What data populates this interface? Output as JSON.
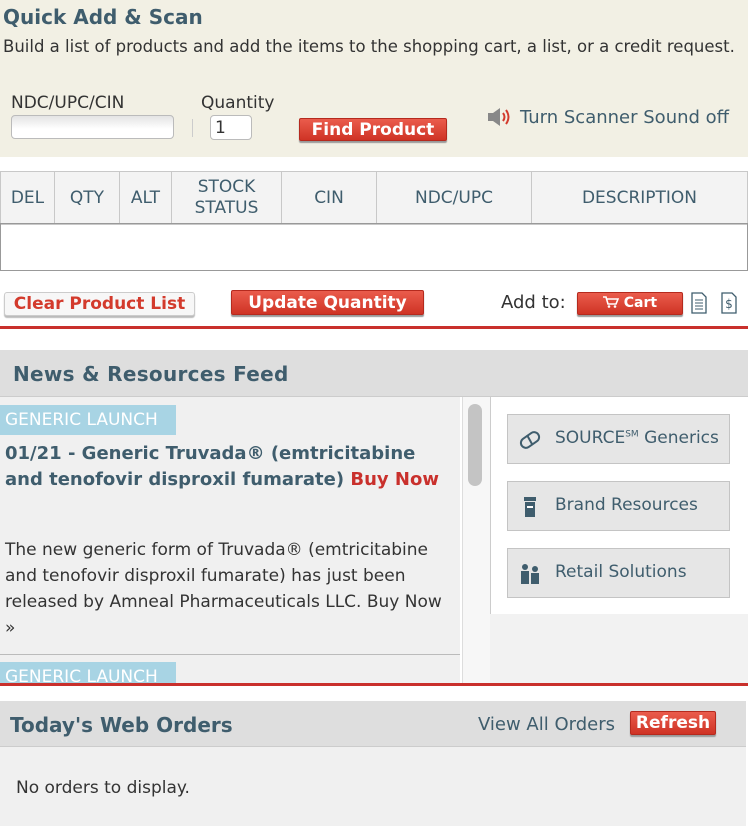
{
  "quick_add": {
    "title": "Quick Add & Scan",
    "description": "Build a list of products and add the items to the shopping cart, a list, or a credit request.",
    "ndc_label": "NDC/UPC/CIN",
    "ndc_value": "",
    "quantity_label": "Quantity",
    "quantity_value": "1",
    "find_button": "Find Product",
    "scanner_toggle": "Turn Scanner Sound off"
  },
  "table": {
    "columns": [
      "DEL",
      "QTY",
      "ALT",
      "STOCK STATUS",
      "CIN",
      "NDC/UPC",
      "DESCRIPTION"
    ]
  },
  "actions": {
    "clear_button": "Clear Product List",
    "update_button": "Update Quantity",
    "add_to_label": "Add to:",
    "cart_button": "Cart"
  },
  "news": {
    "title": "News & Resources Feed",
    "items": [
      {
        "tag": "GENERIC LAUNCH",
        "title": "01/21 - Generic Truvada® (emtricitabine and tenofovir disproxil fumarate)",
        "buy_link": "Buy Now",
        "body": "The new generic form of Truvada® (emtricitabine and tenofovir disproxil fumarate) has just been released by Amneal Pharmaceuticals LLC. Buy Now »"
      },
      {
        "tag": "GENERIC LAUNCH"
      }
    ],
    "sidebar": {
      "source_generics": "SOURCE",
      "source_sup": "SM",
      "source_suffix": " Generics",
      "brand_resources": "Brand Resources",
      "retail_solutions": "Retail Solutions"
    }
  },
  "orders": {
    "title": "Today's Web Orders",
    "view_all": "View All Orders",
    "refresh_button": "Refresh",
    "empty_text": "No orders to display."
  },
  "colors": {
    "accent_red": "#c9302c",
    "heading_blue": "#3f5d6d",
    "tag_blue": "#a8d4e4",
    "panel_beige": "#f2f0e4"
  }
}
